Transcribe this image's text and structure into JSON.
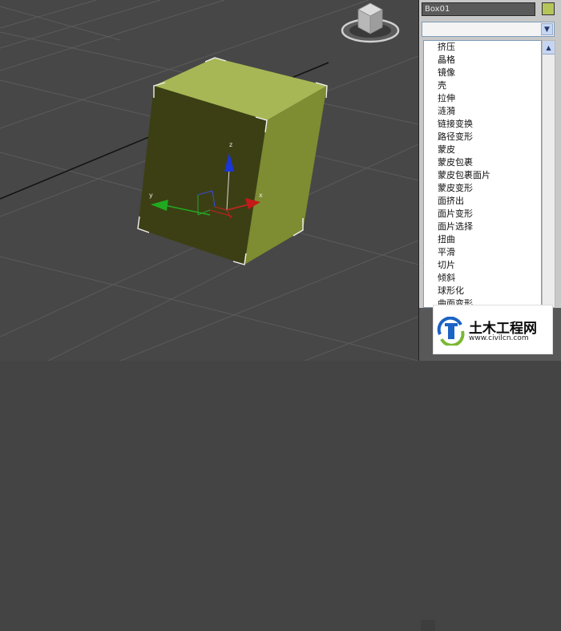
{
  "command_panel": {
    "object_name": "Box01",
    "object_color": "#b5c55a",
    "modifier_list_selected": "",
    "modifiers": [
      "挤压",
      "晶格",
      "镜像",
      "壳",
      "拉伸",
      "涟漪",
      "链接变换",
      "路径变形",
      "蒙皮",
      "蒙皮包裹",
      "蒙皮包裹面片",
      "蒙皮变形",
      "面挤出",
      "面片变形",
      "面片选择",
      "扭曲",
      "平滑",
      "切片",
      "倾斜",
      "球形化",
      "曲面变形"
    ]
  },
  "viewport": {
    "axis_labels": {
      "z": "z",
      "y": "y",
      "x": "x"
    },
    "viewcube_icon": "viewcube-icon"
  },
  "watermark": {
    "title": "土木工程网",
    "url": "www.civilcn.com",
    "colors": {
      "blue": "#1b63c4",
      "green": "#7ab833"
    }
  }
}
